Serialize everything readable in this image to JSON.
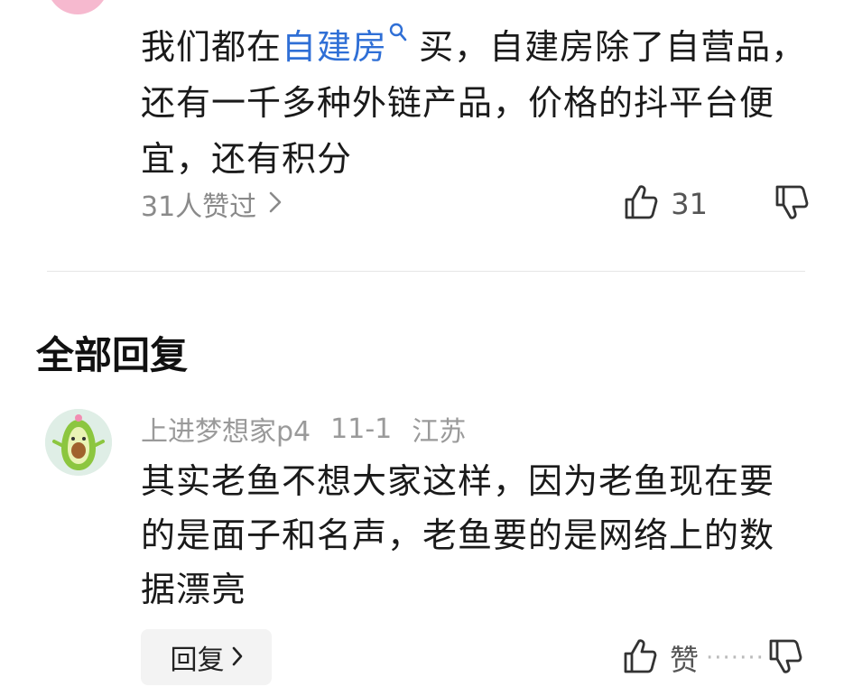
{
  "comment": {
    "text_before": "我们都在",
    "topic": "自建房",
    "text_after": "买，自建房除了自营品，还有一千多种外链产品，价格的抖平台便宜，还有积分",
    "liked_by": "31人赞过",
    "like_count": "31"
  },
  "section": {
    "title": "全部回复"
  },
  "reply": {
    "username": "上进梦想家p4",
    "date": "11-1",
    "location": "江苏",
    "text": "其实老鱼不想大家这样，因为老鱼现在要的是面子和名声，老鱼要的是网络上的数据漂亮",
    "reply_button": "回复",
    "like_label": "赞"
  },
  "colors": {
    "link": "#2f6fd6",
    "muted": "#8a8a8a",
    "text": "#1a1a1a"
  },
  "icons": [
    "search-icon",
    "chevron-right-icon",
    "thumbs-up-icon",
    "thumbs-down-icon"
  ]
}
